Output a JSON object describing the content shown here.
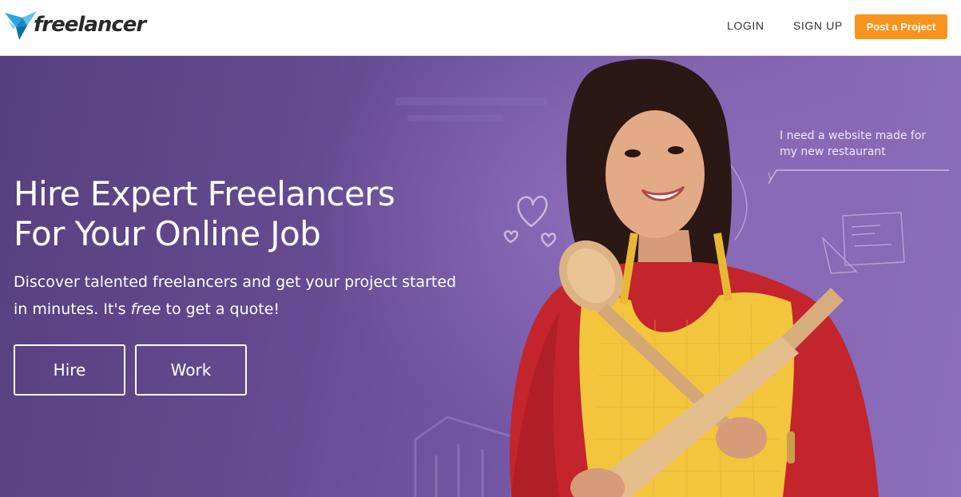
{
  "header": {
    "logo_text": "freelancer",
    "nav": {
      "login": "LOGIN",
      "signup": "SIGN UP",
      "post_project": "Post a Project"
    }
  },
  "hero": {
    "title_lines": [
      "Hire Expert Freelancers",
      "For Your Online Job"
    ],
    "subtitle_line1": "Discover talented freelancers and get your project started",
    "subtitle_line2_before": "in minutes. It's ",
    "subtitle_line2_em": "free",
    "subtitle_line2_after": " to get a quote!",
    "buttons": {
      "hire": "Hire",
      "work": "Work"
    },
    "speech_lines": [
      "I need a website made for",
      "my new restaurant"
    ]
  },
  "colors": {
    "accent_orange": "#f7941d",
    "hero_purple": "#6b4f9b",
    "logo_blue": "#2aa6de"
  },
  "icons": [
    "freelancer-bird-logo-icon",
    "heart-doodle-icon",
    "blueprint-doodle-icon",
    "building-doodle-icon"
  ]
}
